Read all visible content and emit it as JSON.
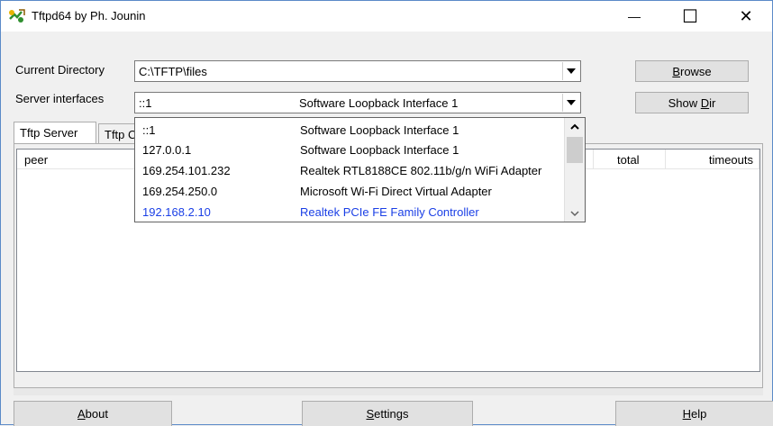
{
  "window": {
    "title": "Tftpd64 by Ph. Jounin",
    "controls": {
      "minimize": "—",
      "maximize": "☐",
      "close": "✕"
    }
  },
  "current_directory": {
    "label": "Current Directory",
    "value": "C:\\TFTP\\files"
  },
  "server_interfaces": {
    "label": "Server interfaces",
    "selected_ip": "::1",
    "selected_desc": "Software Loopback Interface 1"
  },
  "buttons": {
    "browse_prefix": "",
    "browse_ul": "B",
    "browse_rest": "rowse",
    "showdir_prefix": "Show ",
    "showdir_ul": "D",
    "showdir_rest": "ir"
  },
  "tabs": [
    {
      "label": "Tftp Server"
    },
    {
      "label": "Tftp Client"
    }
  ],
  "list_columns": {
    "peer": "peer",
    "total": "total",
    "timeouts": "timeouts"
  },
  "dropdown_items": [
    {
      "ip": "::1",
      "desc": "Software Loopback Interface 1"
    },
    {
      "ip": "127.0.0.1",
      "desc": "Software Loopback Interface 1"
    },
    {
      "ip": "169.254.101.232",
      "desc": "Realtek RTL8188CE 802.11b/g/n WiFi Adapter"
    },
    {
      "ip": "169.254.250.0",
      "desc": "Microsoft Wi-Fi Direct Virtual Adapter"
    },
    {
      "ip": "192.168.2.10",
      "desc": "Realtek PCIe FE Family Controller"
    }
  ],
  "bottom_buttons": {
    "about_ul": "A",
    "about_rest": "bout",
    "settings_ul": "S",
    "settings_rest": "ettings",
    "help_ul": "H",
    "help_rest": "elp"
  },
  "colors": {
    "selected_item": "#1a3fe6",
    "window_border": "#5b8ac8"
  }
}
